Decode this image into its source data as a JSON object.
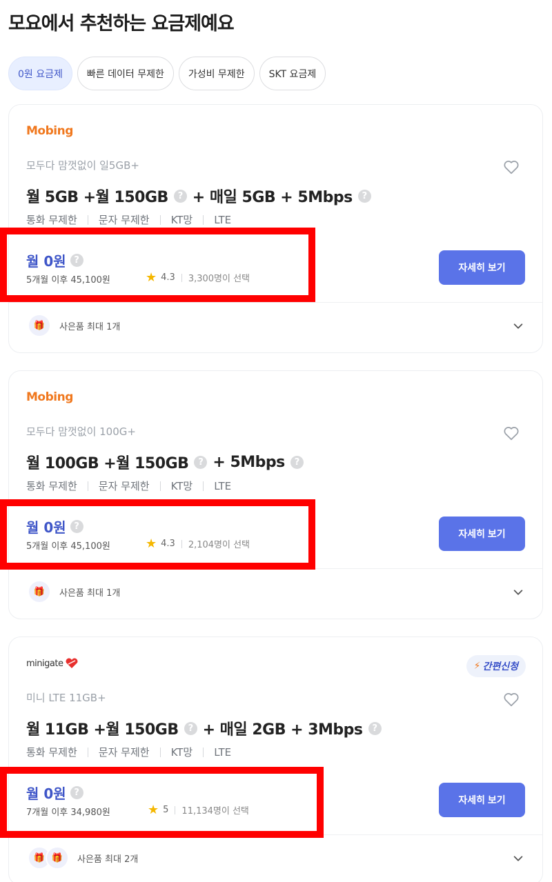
{
  "header": {
    "title": "모요에서 추천하는 요금제예요"
  },
  "filters": [
    {
      "label": "0원 요금제",
      "active": true
    },
    {
      "label": "빠른 데이터 무제한",
      "active": false
    },
    {
      "label": "가성비 무제한",
      "active": false
    },
    {
      "label": "SKT 요금제",
      "active": false
    }
  ],
  "plans": [
    {
      "brand": "Mobing",
      "subtitle": "모두다 맘껏없이 일5GB+",
      "title_parts": [
        "월 5GB +월 150GB",
        "+ 매일 5GB + 5Mbps"
      ],
      "features": [
        "통화 무제한",
        "문자 무제한",
        "KT망",
        "LTE"
      ],
      "price": "월 0원",
      "after_price": "5개월 이후 45,100원",
      "rating": "4.3",
      "selected": "3,300명이 선택",
      "detail_label": "자세히 보기",
      "gift_label": "사은품 최대 1개"
    },
    {
      "brand": "Mobing",
      "subtitle": "모두다 맘껏없이 100G+",
      "title_parts": [
        "월 100GB +월 150GB",
        "+ 5Mbps"
      ],
      "features": [
        "통화 무제한",
        "문자 무제한",
        "KT망",
        "LTE"
      ],
      "price": "월 0원",
      "after_price": "5개월 이후 45,100원",
      "rating": "4.3",
      "selected": "2,104명이 선택",
      "detail_label": "자세히 보기",
      "gift_label": "사은품 최대 1개"
    },
    {
      "brand": "minigate",
      "badge": "간편신청",
      "subtitle": "미니 LTE 11GB+",
      "title_parts": [
        "월 11GB +월 150GB",
        "+ 매일 2GB + 3Mbps"
      ],
      "features": [
        "통화 무제한",
        "문자 무제한",
        "KT망",
        "LTE"
      ],
      "price": "월 0원",
      "after_price": "7개월 이후 34,980원",
      "rating": "5",
      "selected": "11,134명이 선택",
      "detail_label": "자세히 보기",
      "gift_label": "사은품 최대 2개"
    }
  ],
  "colors": {
    "accent": "#5a73e8",
    "price": "#3f56c8",
    "highlight": "#ff0000",
    "brand_mobing": "#f0781e"
  }
}
